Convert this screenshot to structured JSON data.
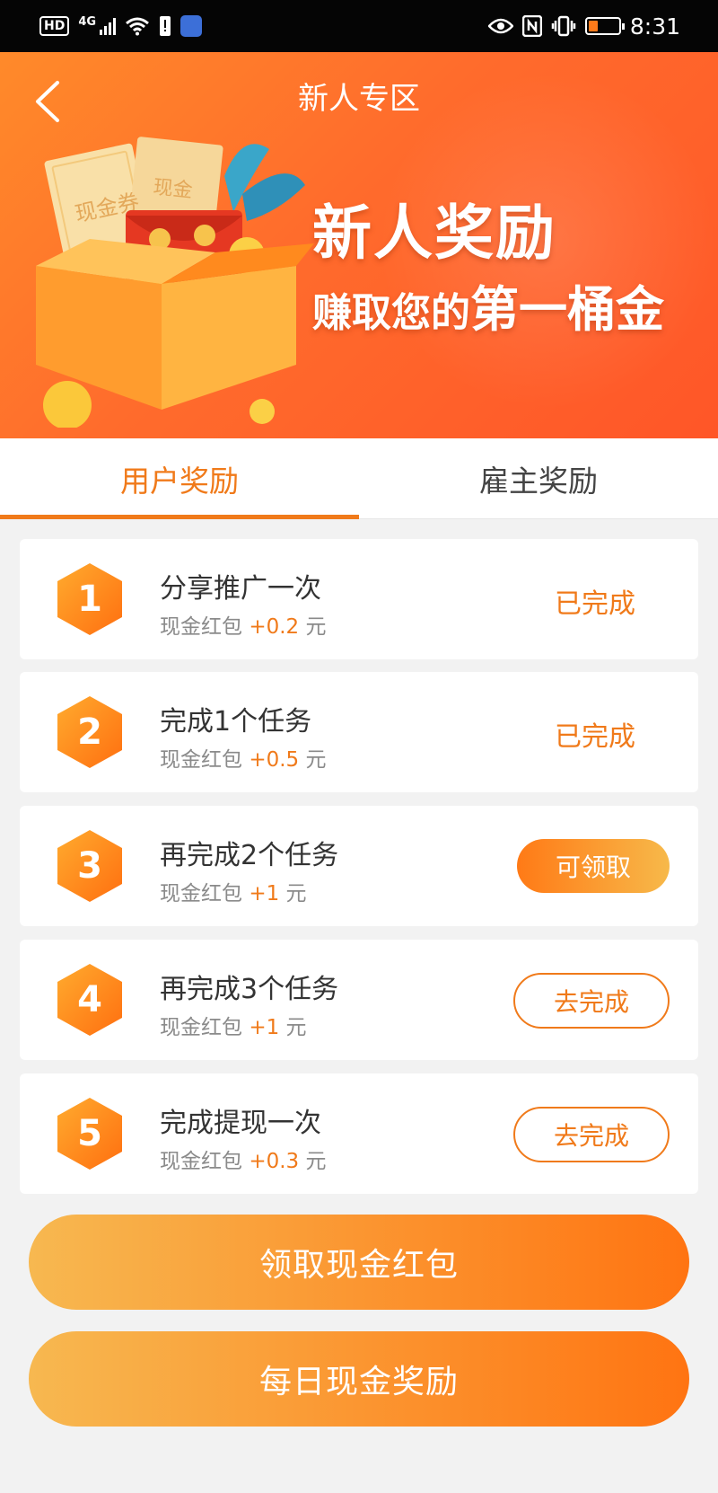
{
  "status_bar": {
    "left_badges": [
      "HD",
      "4G"
    ],
    "time": "8:31",
    "icons": [
      "signal-icon",
      "wifi-icon",
      "alert-icon",
      "music-app-icon",
      "eye-icon",
      "nfc-icon",
      "vibrate-icon",
      "battery-icon"
    ]
  },
  "header": {
    "title": "新人专区",
    "back_icon": "chevron-left-icon"
  },
  "banner": {
    "line1": "新人奖励",
    "line2_prefix": "赚取您的",
    "line2_emphasis": "第一桶金",
    "coupon_text_1": "现金券",
    "coupon_text_2": "现金"
  },
  "tabs": [
    {
      "label": "用户奖励",
      "active": true
    },
    {
      "label": "雇主奖励",
      "active": false
    }
  ],
  "tasks": [
    {
      "num": "1",
      "title": "分享推广一次",
      "sub_prefix": "现金红包",
      "amount": "+0.2",
      "unit": "元",
      "action": "已完成",
      "state": "done"
    },
    {
      "num": "2",
      "title": "完成1个任务",
      "sub_prefix": "现金红包",
      "amount": "+0.5",
      "unit": "元",
      "action": "已完成",
      "state": "done"
    },
    {
      "num": "3",
      "title": "再完成2个任务",
      "sub_prefix": "现金红包",
      "amount": "+1",
      "unit": "元",
      "action": "可领取",
      "state": "claim"
    },
    {
      "num": "4",
      "title": "再完成3个任务",
      "sub_prefix": "现金红包",
      "amount": "+1",
      "unit": "元",
      "action": "去完成",
      "state": "todo"
    },
    {
      "num": "5",
      "title": "完成提现一次",
      "sub_prefix": "现金红包",
      "amount": "+0.3",
      "unit": "元",
      "action": "去完成",
      "state": "todo"
    }
  ],
  "buttons": {
    "claim_cash": "领取现金红包",
    "daily_reward": "每日现金奖励"
  },
  "colors": {
    "accent": "#f07a1a",
    "banner": "#ff6b2c",
    "status_bar": "#050505"
  }
}
